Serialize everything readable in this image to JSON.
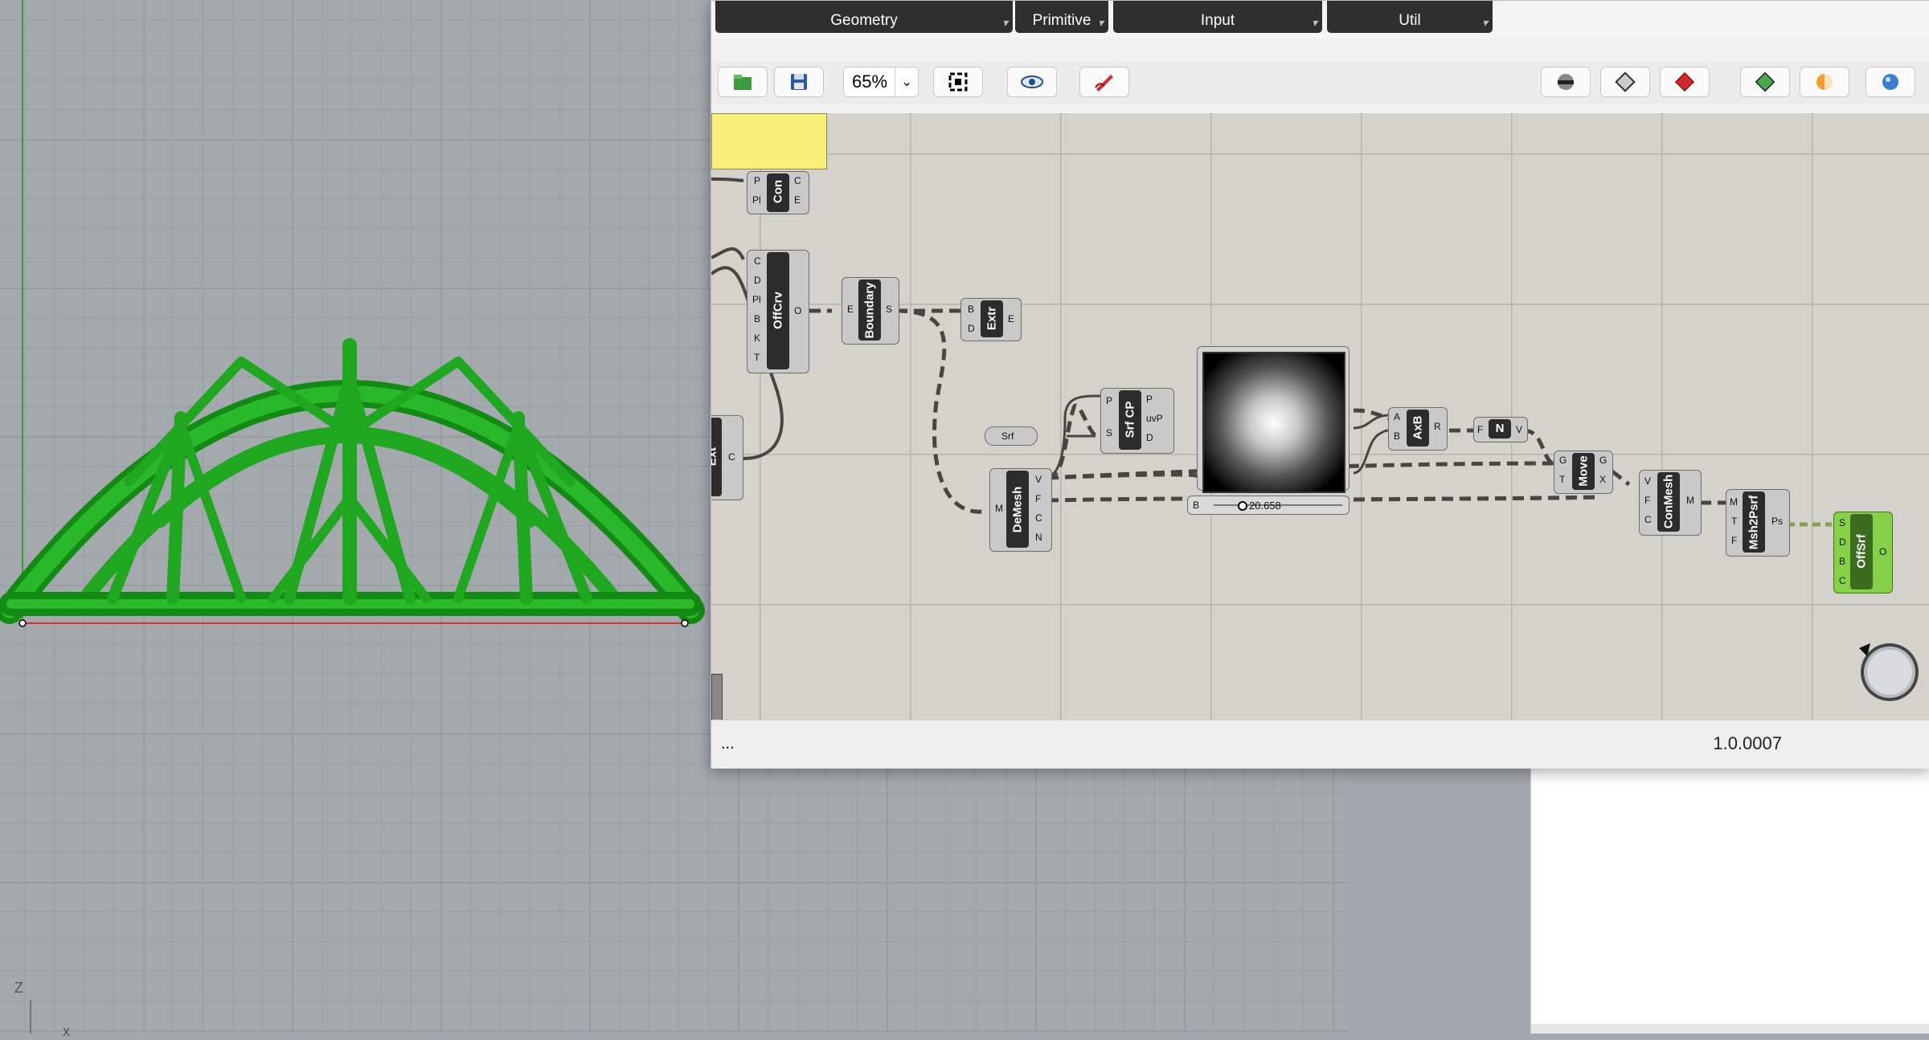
{
  "viewport": {
    "axis_labels": {
      "z": "Z",
      "x": "x"
    },
    "colors": {
      "structure": "#1fa81f",
      "structure_dark": "#138a13",
      "baseline": "#d43030",
      "yaxis": "#3a9a3a"
    }
  },
  "grasshopper": {
    "tabs": [
      {
        "label": "Geometry"
      },
      {
        "label": "Primitive"
      },
      {
        "label": "Input"
      },
      {
        "label": "Util"
      }
    ],
    "toolbar": {
      "zoom_value": "65%",
      "icons": [
        "open-file-icon",
        "save-icon",
        "zoom-extents-icon",
        "preview-icon",
        "sketch-icon",
        "preview-mode-icon",
        "wireframe-icon",
        "shaded-icon",
        "selected-preview-icon",
        "material-icon",
        "render-icon"
      ]
    },
    "components": {
      "con": {
        "name": "Con",
        "inputs": [
          "P",
          "Pl"
        ],
        "outputs": [
          "C",
          "E"
        ]
      },
      "offcrv": {
        "name": "OffCrv",
        "inputs": [
          "C",
          "D",
          "Pl",
          "B",
          "K",
          "T"
        ],
        "outputs": [
          "O"
        ]
      },
      "boundary": {
        "name": "Boundary",
        "inputs": [
          "E"
        ],
        "outputs": [
          "S"
        ]
      },
      "extr": {
        "name": "Extr",
        "inputs": [
          "B",
          "D"
        ],
        "outputs": [
          "E"
        ]
      },
      "ext_partial": {
        "name": "Ext",
        "outputs": [
          "C"
        ]
      },
      "srf_param": {
        "name": "Srf"
      },
      "srfcp": {
        "name": "Srf CP",
        "inputs": [
          "P",
          "S"
        ],
        "outputs": [
          "P",
          "uvP",
          "D"
        ]
      },
      "demesh": {
        "name": "DeMesh",
        "inputs": [
          "M"
        ],
        "outputs": [
          "V",
          "F",
          "C",
          "N"
        ]
      },
      "gradient": {
        "input": "B",
        "slider_value": "20.658"
      },
      "axb": {
        "name": "AxB",
        "inputs": [
          "A",
          "B"
        ],
        "outputs": [
          "R"
        ]
      },
      "neg": {
        "name": "N",
        "inputs": [
          "F"
        ],
        "outputs": [
          "V"
        ]
      },
      "move": {
        "name": "Move",
        "inputs": [
          "G",
          "T"
        ],
        "outputs": [
          "G",
          "X"
        ]
      },
      "conmesh": {
        "name": "ConMesh",
        "inputs": [
          "V",
          "F",
          "C"
        ],
        "outputs": [
          "M"
        ]
      },
      "msh2psrf": {
        "name": "Msh2Psrf",
        "inputs": [
          "M",
          "T",
          "F"
        ],
        "outputs": [
          "Ps"
        ]
      },
      "offsrf": {
        "name": "OffSrf",
        "inputs": [
          "S",
          "D",
          "B",
          "C"
        ],
        "outputs": [
          "O"
        ]
      }
    },
    "status": {
      "left": "...",
      "version": "1.0.0007"
    },
    "colors": {
      "canvas": "#d5d2cb",
      "component": "#c9c9c9",
      "wire": "#4a4540",
      "selected": "#86d04a"
    }
  }
}
